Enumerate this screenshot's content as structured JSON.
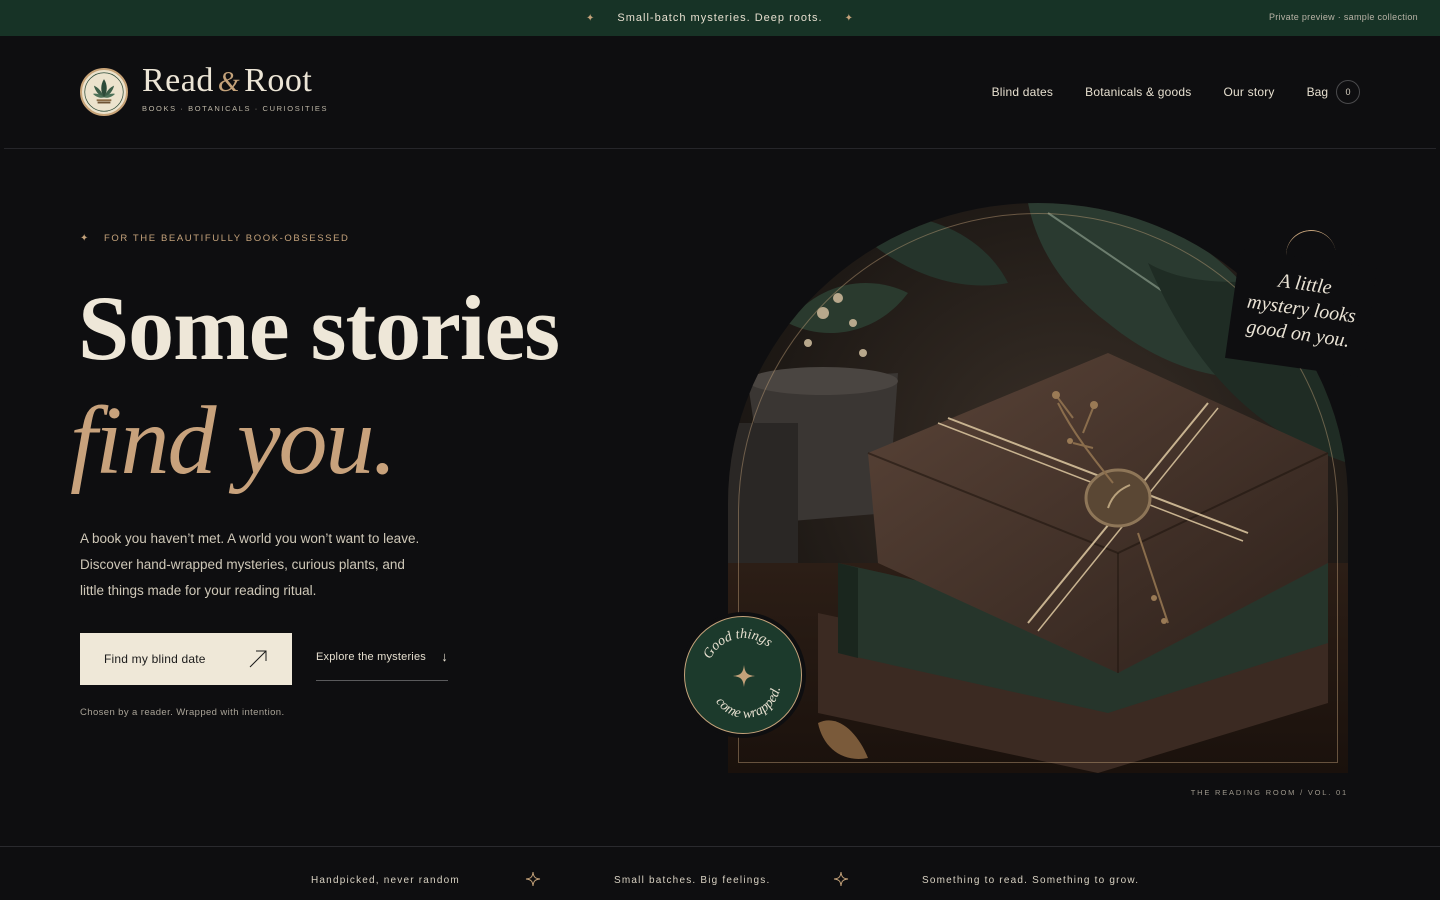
{
  "announcement": {
    "message": "Small-batch mysteries. Deep roots.",
    "spark": "✦",
    "right_note": "Private preview · sample collection"
  },
  "brand": {
    "name_part1": "Read",
    "ampersand": "&",
    "name_part2": "Root",
    "tagline": "BOOKS · BOTANICALS · CURIOSITIES"
  },
  "nav": {
    "items": [
      "Blind dates",
      "Botanicals & goods",
      "Our story"
    ],
    "bag_label": "Bag",
    "bag_count": "0"
  },
  "hero": {
    "eyebrow": "FOR THE BEAUTIFULLY BOOK-OBSESSED",
    "headline_1": "Some stories",
    "headline_2": "find you.",
    "lead_lines": [
      "A book you haven’t met. A world you won’t want to leave.",
      "Discover hand-wrapped mysteries, curious plants, and",
      "little things made for your reading ritual."
    ],
    "primary_cta": "Find my blind date",
    "secondary_cta": "Explore the mysteries",
    "caption": "Chosen by a reader. Wrapped with intention."
  },
  "image_card": {
    "quote_lines": [
      "A little",
      "mystery looks",
      "good on you."
    ],
    "seal_top": "Good things",
    "seal_bottom": "come wrapped.",
    "caption": "THE READING ROOM / VOL. 01"
  },
  "strip": {
    "items": [
      "Handpicked, never random",
      "Small batches. Big feelings.",
      "Something to read. Something to grow."
    ]
  },
  "colors": {
    "background": "#0e0e10",
    "announcement_bg": "#173326",
    "accent_gold": "#c4a27a",
    "cream": "#efe8d8",
    "seal_green": "#1c3a2c"
  }
}
